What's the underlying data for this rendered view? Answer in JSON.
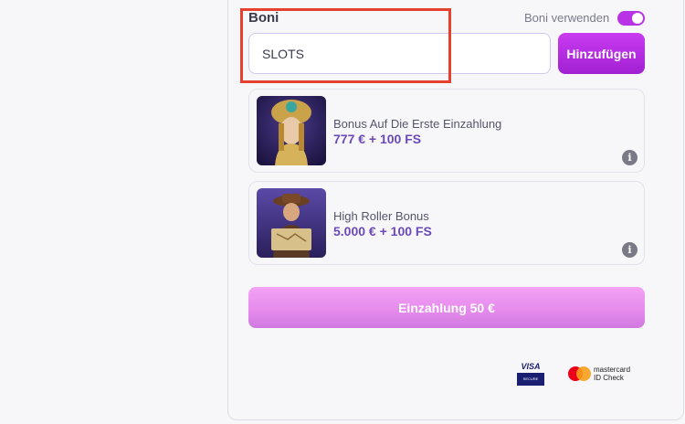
{
  "bonus_section": {
    "title": "Boni",
    "toggle_label": "Boni verwenden",
    "toggle_on": true,
    "code_input_value": "SLOTS",
    "add_button_label": "Hinzufügen"
  },
  "bonuses": [
    {
      "name": "Bonus Auf Die Erste Einzahlung",
      "value": "777 € + 100 FS",
      "info_icon": "info-icon"
    },
    {
      "name": "High Roller Bonus",
      "value": "5.000 € + 100 FS",
      "info_icon": "info-icon"
    }
  ],
  "deposit_button_label": "Einzahlung 50 €",
  "payment_badges": {
    "visa_top": "VISA",
    "visa_bottom": "SECURE",
    "mastercard_line1": "mastercard",
    "mastercard_line2": "ID Check"
  },
  "colors": {
    "accent": "#b833e6",
    "highlight_box": "#e6412f",
    "bonus_value": "#6a4ab8"
  }
}
